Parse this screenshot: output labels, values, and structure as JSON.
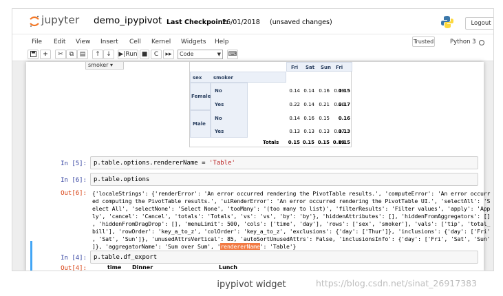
{
  "header": {
    "logo_text": "jupyter",
    "notebook_name": "demo_ipypivot",
    "checkpoint_label": "Last Checkpoint:",
    "checkpoint_date": "26/01/2018",
    "checkpoint_note": "(unsaved changes)",
    "logout_label": "Logout",
    "python_logo_icon": "python-logo-icon"
  },
  "menubar": {
    "items": [
      "File",
      "Edit",
      "View",
      "Insert",
      "Cell",
      "Kernel",
      "Widgets",
      "Help"
    ],
    "trusted_label": "Trusted",
    "kernel_name": "Python 3"
  },
  "toolbar": {
    "icons": [
      "save-icon",
      "add-cell-icon",
      "cut-icon",
      "copy-icon",
      "paste-icon",
      "move-up-icon",
      "move-down-icon",
      "run-icon",
      "stop-icon",
      "restart-icon",
      "fast-forward-icon"
    ],
    "run_label": "Run",
    "cell_type": "Code",
    "keyboard_icon": "keyboard-icon"
  },
  "pivot": {
    "attr_dropdown": "smoker",
    "col_headers": [
      "Fri",
      "Sat",
      "Sun",
      "Fri"
    ],
    "row_attr_headers": [
      "sex",
      "smoker"
    ],
    "rows": [
      {
        "sex": "Female",
        "smoker": "No",
        "values": [
          "0.14",
          "0.14",
          "0.16",
          "0.19"
        ],
        "total": "0.15"
      },
      {
        "sex": "",
        "smoker": "Yes",
        "values": [
          "0.22",
          "0.14",
          "0.21",
          "0.20"
        ],
        "total": "0.17"
      },
      {
        "sex": "Male",
        "smoker": "No",
        "values": [
          "0.14",
          "0.16",
          "0.15",
          ""
        ],
        "total": "0.16"
      },
      {
        "sex": "",
        "smoker": "Yes",
        "values": [
          "0.13",
          "0.13",
          "0.13",
          "0.17"
        ],
        "total": "0.13"
      }
    ],
    "totals_label": "Totals",
    "totals": [
      "0.15",
      "0.15",
      "0.15",
      "0.19",
      "0.15"
    ]
  },
  "cells": {
    "c5": {
      "prompt": "In [5]:",
      "code_a": "p.table.options.rendererName = ",
      "code_str": "'Table'"
    },
    "c6": {
      "prompt": "In [6]:",
      "code": "p.table.options",
      "out_prompt": "Out[6]:"
    },
    "c4": {
      "prompt": "In [4]:",
      "code": "p.table.df_export",
      "out_prompt": "Out[4]:"
    }
  },
  "output6": {
    "lines": [
      "{'localeStrings': {'renderError': 'An error occurred rendering the PivotTable results.', 'computeError': 'An error occurr",
      "ed computing the PivotTable results.', 'uiRenderError': 'An error occurred rendering the PivotTable UI.', 'selectAll': 'S",
      "elect All', 'selectNone': 'Select None', 'tooMany': '(too many to list)', 'filterResults': 'Filter values', 'apply': 'App",
      "ly', 'cancel': 'Cancel', 'totals': 'Totals', 'vs': 'vs', 'by': 'by'}, 'hiddenAttributes': [], 'hiddenFromAggregators': []",
      ", 'hiddenFromDragDrop': [], 'menuLimit': 500, 'cols': ['time', 'day'], 'rows': ['sex', 'smoker'], 'vals': ['tip', 'total_",
      "bill'], 'rowOrder': 'key_a_to_z', 'colOrder': 'key_a_to_z', 'exclusions': {'day': ['Thur']}, 'inclusions': {'day': ['Fri'",
      ", 'Sat', 'Sun']}, 'unusedAttrsVertical': 85, 'autoSortUnusedAttrs': False, 'inclusionsInfo': {'day': ['Fri', 'Sat', 'Sun'"
    ],
    "last_a": "]}, 'aggregatorName': 'Sum over Sum', '",
    "last_hl": "rendererName",
    "last_b": "': 'Table'}"
  },
  "df_export": {
    "headers": [
      "time",
      "Dinner",
      "Lunch"
    ]
  },
  "caption": "ipypivot widget",
  "watermark": "https://blog.csdn.net/sinat_26917383",
  "colors": {
    "accent": "#f27a43",
    "prompt_in": "#303f9f",
    "prompt_out": "#d84315",
    "selection": "#42a5f5"
  }
}
